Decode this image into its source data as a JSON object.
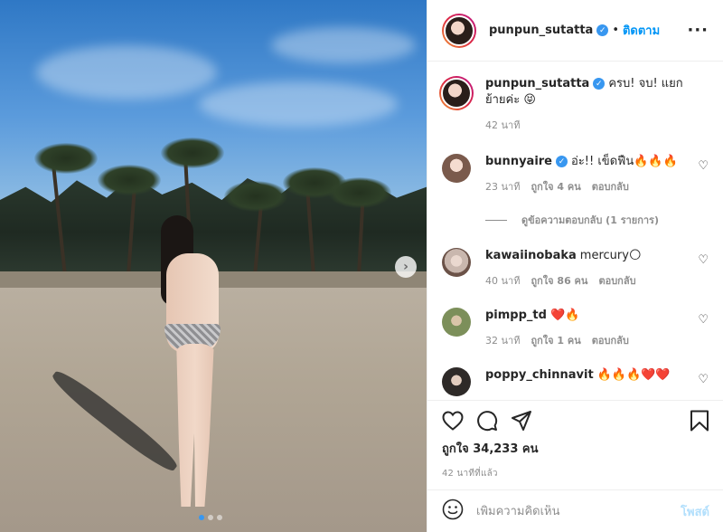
{
  "post_author": {
    "username": "punpun_sutatta",
    "verified": true,
    "follow_label": "ติดตาม",
    "separator": "•"
  },
  "menu_icon": "more-horizontal-icon",
  "caption": {
    "username": "punpun_sutatta",
    "text": "ครบ! จบ! แยกย้ายค่ะ 😝",
    "time": "42 นาที"
  },
  "comments": [
    {
      "username": "bunnyaire",
      "verified": true,
      "text": "อ่ะ!! เข็ดฟืน🔥🔥🔥",
      "time": "23 นาที",
      "likes": "ถูกใจ 4 คน",
      "reply": "ตอบกลับ",
      "view_replies": "ดูข้อความตอบกลับ (1 รายการ)"
    },
    {
      "username": "kawaiinobaka",
      "verified": false,
      "text": "mercury🌕",
      "time": "40 นาที",
      "likes": "ถูกใจ 86 คน",
      "reply": "ตอบกลับ"
    },
    {
      "username": "pimpp_td",
      "verified": false,
      "text": "❤️🔥",
      "time": "32 นาที",
      "likes": "ถูกใจ 1 คน",
      "reply": "ตอบกลับ"
    },
    {
      "username": "poppy_chinnavit",
      "verified": false,
      "text": "🔥🔥🔥❤️❤️"
    }
  ],
  "likes_total": "ถูกใจ 34,233 คน",
  "posted_ago": "42 นาทีที่แล้ว",
  "add_comment": {
    "placeholder": "เพิ่มความคิดเห็น",
    "post_label": "โพสต์"
  },
  "carousel": {
    "slide_count": 3,
    "active_index": 0,
    "next_icon": "chevron-right-icon"
  },
  "colors": {
    "accent": "#0095f6",
    "verified": "#3897f0",
    "muted": "#8e8e8e"
  }
}
